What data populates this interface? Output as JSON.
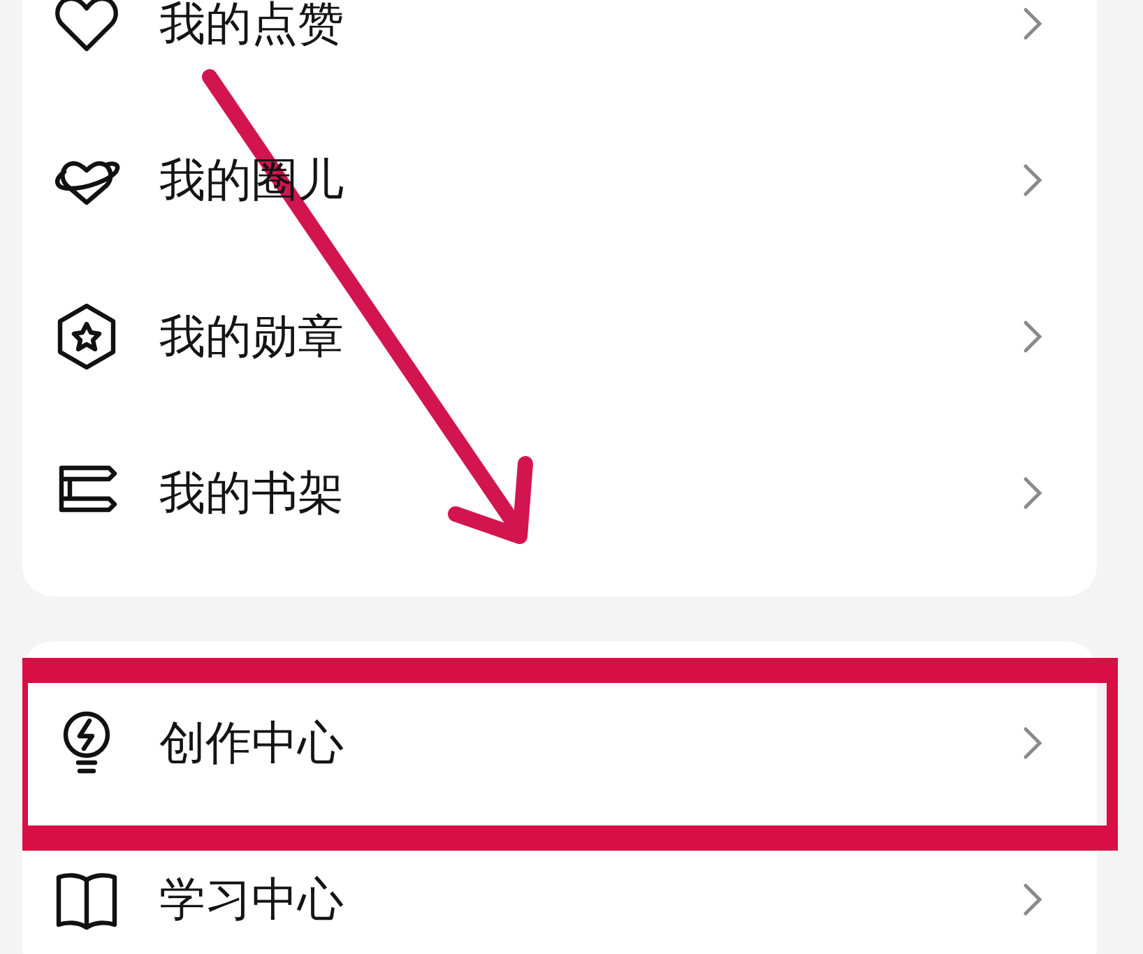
{
  "sections": [
    {
      "items": [
        {
          "kind": "heart",
          "label": "我的点赞",
          "highlighted": false
        },
        {
          "kind": "planet",
          "label": "我的圈儿",
          "highlighted": false
        },
        {
          "kind": "badge",
          "label": "我的勋章",
          "highlighted": false
        },
        {
          "kind": "shelf",
          "label": "我的书架",
          "highlighted": false
        }
      ]
    },
    {
      "items": [
        {
          "kind": "bulb",
          "label": "创作中心",
          "highlighted": true
        },
        {
          "kind": "book",
          "label": "学习中心",
          "highlighted": false
        }
      ]
    }
  ],
  "annotation": {
    "arrow": true
  }
}
